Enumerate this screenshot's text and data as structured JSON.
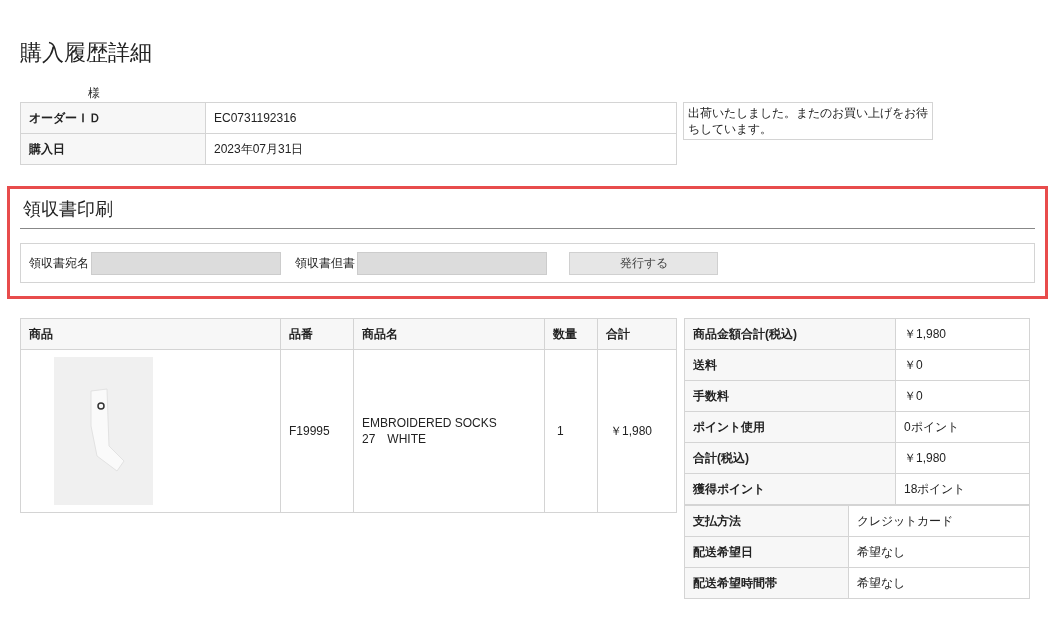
{
  "title": "購入履歴詳細",
  "customer": {
    "honorific": "様"
  },
  "order_info": [
    {
      "label": "オーダーＩＤ",
      "value": "EC0731192316"
    },
    {
      "label": "購入日",
      "value": "2023年07月31日"
    }
  ],
  "message": "出荷いたしました。またのお買い上げをお待ちしています。",
  "receipt": {
    "title": "領収書印刷",
    "fields": [
      {
        "label": "領収書宛名"
      },
      {
        "label": "領収書但書"
      }
    ],
    "button": "発行する"
  },
  "products": {
    "columns": [
      "商品",
      "品番",
      "商品名",
      "数量",
      "合計"
    ],
    "rows": [
      {
        "code": "F19995",
        "name_lines": [
          "EMBROIDERED SOCKS",
          "27　WHITE"
        ],
        "quantity": "1",
        "total": "￥1,980"
      }
    ]
  },
  "summary": [
    {
      "label": "商品金額合計(税込)",
      "value": "￥1,980"
    },
    {
      "label": "送料",
      "value": "￥0"
    },
    {
      "label": "手数料",
      "value": "￥0"
    },
    {
      "label": "ポイント使用",
      "value": "0ポイント"
    },
    {
      "label": "合計(税込)",
      "value": "￥1,980"
    },
    {
      "label": "獲得ポイント",
      "value": "18ポイント"
    }
  ],
  "delivery": [
    {
      "label": "支払方法",
      "value": "クレジットカード"
    },
    {
      "label": "配送希望日",
      "value": "希望なし"
    },
    {
      "label": "配送希望時間帯",
      "value": "希望なし"
    }
  ]
}
